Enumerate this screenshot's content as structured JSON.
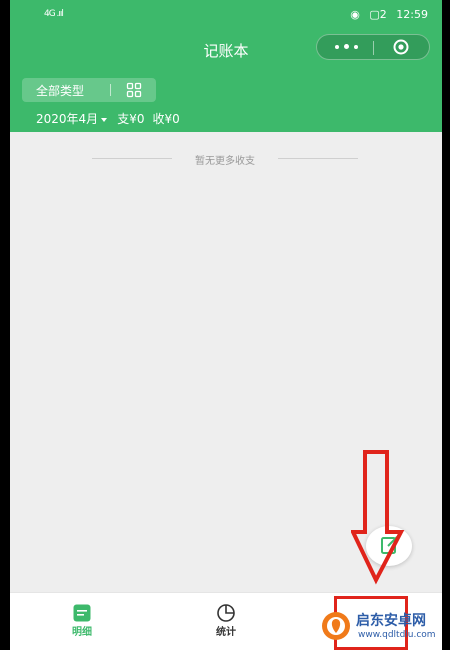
{
  "status_bar": {
    "signal": "4G .ııl",
    "battery": "▢2",
    "time": "12:59"
  },
  "header": {
    "title": "记账本"
  },
  "filter": {
    "type_label": "全部类型"
  },
  "summary": {
    "month": "2020年4月",
    "expense": "支¥0",
    "income": "收¥0"
  },
  "list": {
    "empty_text": "暂无更多收支"
  },
  "tabs": [
    {
      "label": "明细",
      "icon": "list-icon",
      "color": "#3db96b"
    },
    {
      "label": "统计",
      "icon": "pie-chart-icon",
      "color": "#333333"
    }
  ],
  "watermark": {
    "name": "启东安卓网",
    "url": "www.qdltdlu.com"
  },
  "colors": {
    "brand": "#3db96b",
    "annotation": "#e0241b"
  }
}
